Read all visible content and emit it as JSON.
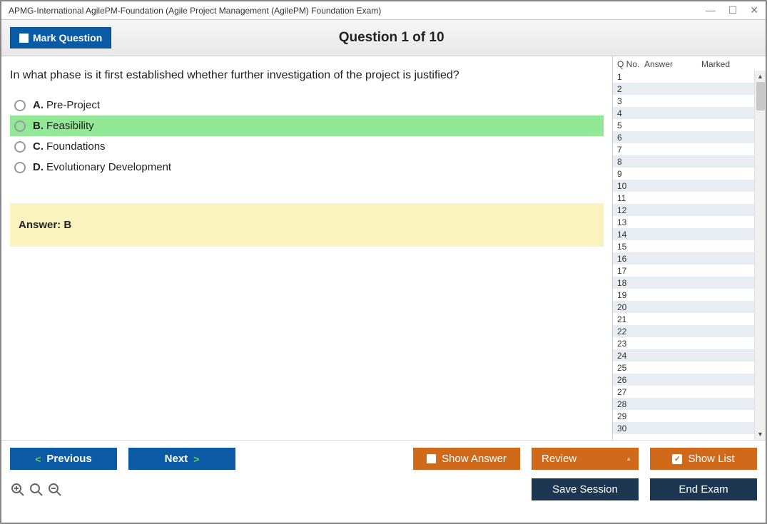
{
  "window": {
    "title": "APMG-International AgilePM-Foundation (Agile Project Management (AgilePM) Foundation Exam)"
  },
  "header": {
    "mark_question_label": "Mark Question",
    "question_title": "Question 1 of 10"
  },
  "question": {
    "text": "In what phase is it first established whether further investigation of the project is justified?",
    "options": [
      {
        "letter": "A.",
        "text": "Pre-Project",
        "correct": false
      },
      {
        "letter": "B.",
        "text": "Feasibility",
        "correct": true
      },
      {
        "letter": "C.",
        "text": "Foundations",
        "correct": false
      },
      {
        "letter": "D.",
        "text": "Evolutionary Development",
        "correct": false
      }
    ],
    "answer_box": "Answer: B"
  },
  "side": {
    "col_q": "Q No.",
    "col_a": "Answer",
    "col_m": "Marked",
    "row_count": 30
  },
  "footer": {
    "previous": "Previous",
    "next": "Next",
    "show_answer": "Show Answer",
    "review": "Review",
    "show_list": "Show List",
    "save_session": "Save Session",
    "end_exam": "End Exam"
  }
}
